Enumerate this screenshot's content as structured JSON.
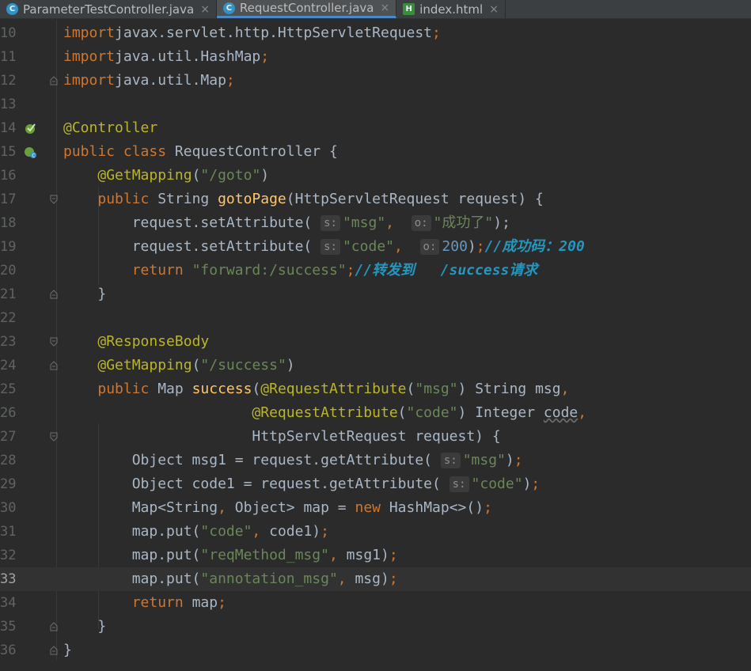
{
  "tabs": [
    {
      "label": "ParameterTestController.java",
      "icon": "java-class-icon",
      "active": false
    },
    {
      "label": "RequestController.java",
      "icon": "java-class-icon",
      "active": true
    },
    {
      "label": "index.html",
      "icon": "html-file-icon",
      "active": false
    }
  ],
  "tab_icon_letters": {
    "java": "C",
    "html": "H"
  },
  "close_glyph": "×",
  "colors": {
    "background": "#2b2b2b",
    "keyword": "#cc7832",
    "annotation": "#bbb529",
    "string": "#6a8759",
    "number": "#6897bb",
    "method": "#ffc66d",
    "comment": "#2596be",
    "text": "#a9b7c6"
  },
  "current_line": 33,
  "lines": [
    {
      "n": "10",
      "tokens": [
        [
          "kw",
          "import"
        ],
        [
          "",
          "javax.servlet.http.HttpServletRequest"
        ],
        [
          "kw",
          ";"
        ]
      ]
    },
    {
      "n": "11",
      "tokens": [
        [
          "kw",
          "import"
        ],
        [
          "",
          "java.util.HashMap"
        ],
        [
          "kw",
          ";"
        ]
      ]
    },
    {
      "n": "12",
      "tokens": [
        [
          "kw",
          "import"
        ],
        [
          "",
          "java.util.Map"
        ],
        [
          "kw",
          ";"
        ]
      ]
    },
    {
      "n": "13",
      "tokens": []
    },
    {
      "n": "14",
      "tokens": [
        [
          "an",
          "@Controller"
        ]
      ]
    },
    {
      "n": "15",
      "tokens": [
        [
          "kw",
          "public class "
        ],
        [
          "",
          "RequestController {"
        ]
      ]
    },
    {
      "n": "16",
      "tokens": [
        [
          "",
          "    "
        ],
        [
          "an",
          "@GetMapping"
        ],
        [
          "",
          "("
        ],
        [
          "st",
          "\"/goto\""
        ],
        [
          "",
          ")"
        ]
      ]
    },
    {
      "n": "17",
      "tokens": [
        [
          "",
          "    "
        ],
        [
          "kw",
          "public "
        ],
        [
          "",
          "String "
        ],
        [
          "fn",
          "gotoPage"
        ],
        [
          "",
          "(HttpServletRequest request) {"
        ]
      ]
    },
    {
      "n": "18",
      "tokens": [
        [
          "",
          "        request.setAttribute( "
        ],
        [
          "hint",
          "s:"
        ],
        [
          "st",
          "\"msg\""
        ],
        [
          "kw",
          ","
        ],
        [
          "",
          "  "
        ],
        [
          "hint",
          "o:"
        ],
        [
          "st",
          "\"成功了\""
        ],
        [
          "",
          "); "
        ]
      ]
    },
    {
      "n": "19",
      "tokens": [
        [
          "",
          "        request.setAttribute( "
        ],
        [
          "hint",
          "s:"
        ],
        [
          "st",
          "\"code\""
        ],
        [
          "kw",
          ","
        ],
        [
          "",
          "  "
        ],
        [
          "hint",
          "o:"
        ],
        [
          "nu",
          "200"
        ],
        [
          "",
          ")"
        ],
        [
          "kw",
          ";"
        ],
        [
          "cm",
          "//成功码：200"
        ]
      ]
    },
    {
      "n": "20",
      "tokens": [
        [
          "",
          "        "
        ],
        [
          "kw",
          "return "
        ],
        [
          "st",
          "\"forward:/success\""
        ],
        [
          "kw",
          ";"
        ],
        [
          "cm",
          "//转发到   /success请求"
        ]
      ]
    },
    {
      "n": "21",
      "tokens": [
        [
          "",
          "    }"
        ]
      ]
    },
    {
      "n": "22",
      "tokens": []
    },
    {
      "n": "23",
      "tokens": [
        [
          "",
          "    "
        ],
        [
          "an",
          "@ResponseBody"
        ]
      ]
    },
    {
      "n": "24",
      "tokens": [
        [
          "",
          "    "
        ],
        [
          "an",
          "@GetMapping"
        ],
        [
          "",
          "("
        ],
        [
          "st",
          "\"/success\""
        ],
        [
          "",
          ")"
        ]
      ]
    },
    {
      "n": "25",
      "tokens": [
        [
          "",
          "    "
        ],
        [
          "kw",
          "public "
        ],
        [
          "",
          "Map "
        ],
        [
          "fn",
          "success"
        ],
        [
          "",
          "("
        ],
        [
          "an",
          "@RequestAttribute"
        ],
        [
          "",
          "("
        ],
        [
          "st",
          "\"msg\""
        ],
        [
          "",
          ") String msg"
        ],
        [
          "kw",
          ","
        ]
      ]
    },
    {
      "n": "26",
      "tokens": [
        [
          "",
          "                      "
        ],
        [
          "an",
          "@RequestAttribute"
        ],
        [
          "",
          "("
        ],
        [
          "st",
          "\"code\""
        ],
        [
          "",
          ") Integer "
        ],
        [
          "wavy",
          "code"
        ],
        [
          "kw",
          ","
        ]
      ]
    },
    {
      "n": "27",
      "tokens": [
        [
          "",
          "                      HttpServletRequest request) {"
        ]
      ]
    },
    {
      "n": "28",
      "tokens": [
        [
          "",
          "        Object msg1 = request.getAttribute( "
        ],
        [
          "hint",
          "s:"
        ],
        [
          "st",
          "\"msg\""
        ],
        [
          "",
          ")"
        ],
        [
          "kw",
          ";"
        ]
      ]
    },
    {
      "n": "29",
      "tokens": [
        [
          "",
          "        Object code1 = request.getAttribute( "
        ],
        [
          "hint",
          "s:"
        ],
        [
          "st",
          "\"code\""
        ],
        [
          "",
          ")"
        ],
        [
          "kw",
          ";"
        ]
      ]
    },
    {
      "n": "30",
      "tokens": [
        [
          "",
          "        Map<String"
        ],
        [
          "kw",
          ", "
        ],
        [
          "",
          "Object> map = "
        ],
        [
          "kw",
          "new "
        ],
        [
          "",
          "HashMap<>()"
        ],
        [
          "kw",
          ";"
        ]
      ]
    },
    {
      "n": "31",
      "tokens": [
        [
          "",
          "        map.put("
        ],
        [
          "st",
          "\"code\""
        ],
        [
          "kw",
          ", "
        ],
        [
          "",
          "code1)"
        ],
        [
          "kw",
          ";"
        ]
      ]
    },
    {
      "n": "32",
      "tokens": [
        [
          "",
          "        map.put("
        ],
        [
          "st",
          "\"reqMethod_msg\""
        ],
        [
          "kw",
          ", "
        ],
        [
          "",
          "msg1)"
        ],
        [
          "kw",
          ";"
        ]
      ]
    },
    {
      "n": "33",
      "tokens": [
        [
          "",
          "        map.put("
        ],
        [
          "st",
          "\"annotation_msg\""
        ],
        [
          "kw",
          ", "
        ],
        [
          "",
          "msg)"
        ],
        [
          "kw",
          ";"
        ]
      ]
    },
    {
      "n": "34",
      "tokens": [
        [
          "",
          "        "
        ],
        [
          "kw",
          "return "
        ],
        [
          "",
          "map"
        ],
        [
          "kw",
          ";"
        ]
      ]
    },
    {
      "n": "35",
      "tokens": [
        [
          "",
          "    }"
        ]
      ]
    },
    {
      "n": "36",
      "tokens": [
        [
          "",
          "}"
        ]
      ]
    }
  ],
  "gutter_icons": {
    "14": "spring-bean-icon",
    "15": "spring-controller-icon"
  },
  "fold_markers": {
    "12": "end",
    "17": "start",
    "21": "end",
    "23": "start",
    "24": "end",
    "27": "start",
    "35": "end",
    "36": "end"
  }
}
